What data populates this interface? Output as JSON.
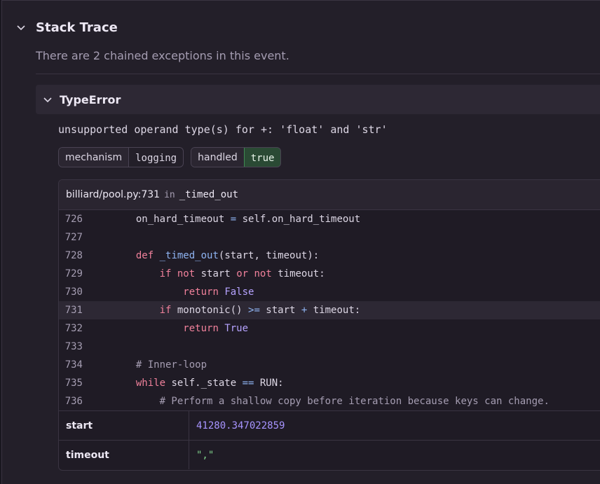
{
  "section": {
    "title": "Stack Trace",
    "summary": "There are 2 chained exceptions in this event."
  },
  "exception": {
    "type": "TypeError",
    "value": "unsupported operand type(s) for +: 'float' and 'str'",
    "tags": [
      {
        "key": "mechanism",
        "value": "logging"
      },
      {
        "key": "handled",
        "value": "true"
      }
    ]
  },
  "frame": {
    "filename": "billiard/pool.py:731",
    "in_label": "in",
    "function": "_timed_out",
    "lines": [
      {
        "num": "726",
        "text": "        on_hard_timeout = self.on_hard_timeout"
      },
      {
        "num": "727",
        "text": ""
      },
      {
        "num": "728",
        "text": "        def _timed_out(start, timeout):"
      },
      {
        "num": "729",
        "text": "            if not start or not timeout:"
      },
      {
        "num": "730",
        "text": "                return False"
      },
      {
        "num": "731",
        "text": "            if monotonic() >= start + timeout:"
      },
      {
        "num": "732",
        "text": "                return True"
      },
      {
        "num": "733",
        "text": ""
      },
      {
        "num": "734",
        "text": "        # Inner-loop"
      },
      {
        "num": "735",
        "text": "        while self._state == RUN:"
      },
      {
        "num": "736",
        "text": "            # Perform a shallow copy before iteration because keys can change."
      }
    ],
    "active_line": "731",
    "variables": [
      {
        "name": "start",
        "value": "41280.347022859"
      },
      {
        "name": "timeout",
        "value": "\",\""
      }
    ]
  },
  "colors": {
    "background": "#231f29",
    "handled_true_bg": "#2a4a34",
    "keyword": "#f0819b",
    "number": "#a794ff",
    "string": "#7fd08a"
  },
  "icons": {
    "section_toggle": "chevron-down-icon",
    "exception_toggle": "chevron-down-icon"
  }
}
